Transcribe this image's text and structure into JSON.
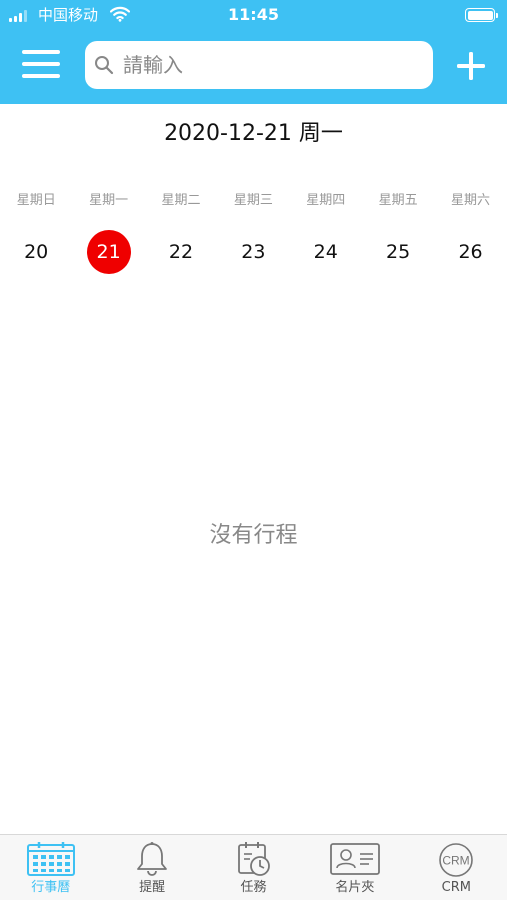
{
  "status_bar": {
    "carrier": "中国移动",
    "time": "11:45"
  },
  "header": {
    "search_placeholder": "請輸入"
  },
  "date_title": "2020-12-21 周一",
  "weekdays": [
    "星期日",
    "星期一",
    "星期二",
    "星期三",
    "星期四",
    "星期五",
    "星期六"
  ],
  "days": [
    "20",
    "21",
    "22",
    "23",
    "24",
    "25",
    "26"
  ],
  "selected_day": "21",
  "empty_text": "沒有行程",
  "tabs": [
    {
      "label": "行事曆",
      "icon": "calendar-icon",
      "active": true
    },
    {
      "label": "提醒",
      "icon": "bell-icon"
    },
    {
      "label": "任務",
      "icon": "task-clock-icon"
    },
    {
      "label": "名片夾",
      "icon": "business-card-icon"
    },
    {
      "label": "CRM",
      "icon": "crm-icon"
    }
  ],
  "colors": {
    "accent": "#3ec1f3",
    "selected_day": "#ef0000"
  }
}
